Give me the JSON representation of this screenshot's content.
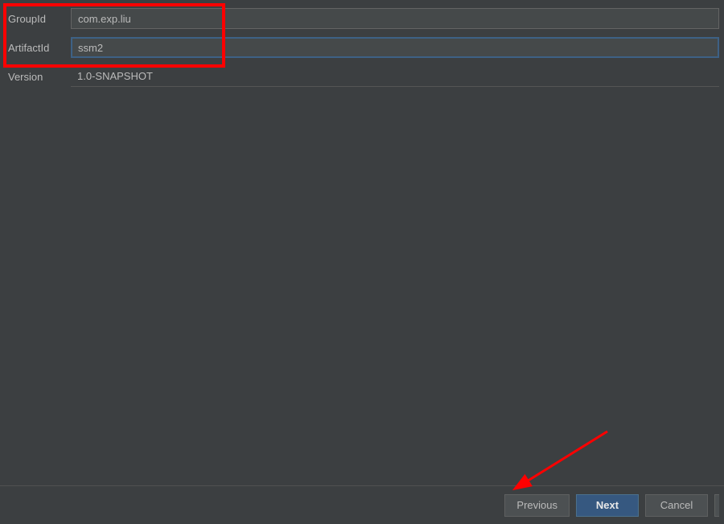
{
  "form": {
    "groupId": {
      "label": "GroupId",
      "value": "com.exp.liu"
    },
    "artifactId": {
      "label": "ArtifactId",
      "value": "ssm2"
    },
    "version": {
      "label": "Version",
      "value": "1.0-SNAPSHOT"
    }
  },
  "footer": {
    "previous": "Previous",
    "next": "Next",
    "cancel": "Cancel"
  }
}
